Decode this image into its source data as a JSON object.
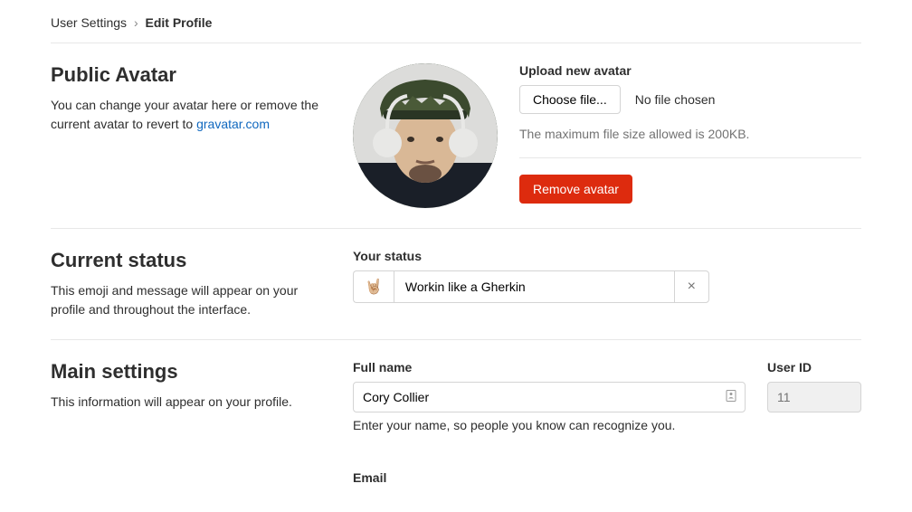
{
  "breadcrumb": {
    "parent": "User Settings",
    "current": "Edit Profile"
  },
  "avatar": {
    "title": "Public Avatar",
    "desc_prefix": "You can change your avatar here or remove the current avatar to revert to ",
    "desc_link": "gravatar.com",
    "upload_label": "Upload new avatar",
    "choose_file": "Choose file...",
    "no_file": "No file chosen",
    "size_hint": "The maximum file size allowed is 200KB.",
    "remove_btn": "Remove avatar"
  },
  "status": {
    "title": "Current status",
    "desc": "This emoji and message will appear on your profile and throughout the interface.",
    "label": "Your status",
    "emoji": "🤘🏼",
    "value": "Workin like a Gherkin",
    "clear": "×"
  },
  "main": {
    "title": "Main settings",
    "desc": "This information will appear on your profile.",
    "fullname_label": "Full name",
    "fullname_value": "Cory Collier",
    "fullname_help": "Enter your name, so people you know can recognize you.",
    "userid_label": "User ID",
    "userid_value": "11",
    "email_label": "Email"
  }
}
